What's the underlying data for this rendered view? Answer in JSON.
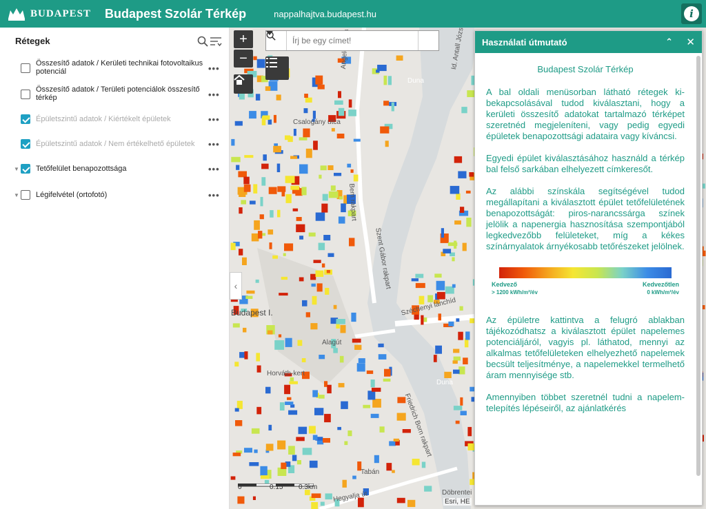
{
  "header": {
    "logo_text": "BUDAPEST",
    "title": "Budapest Szolár Térkép",
    "url": "nappalhajtva.budapest.hu"
  },
  "layers_panel": {
    "title": "Rétegek",
    "items": [
      {
        "label": "Összesítő adatok / Kerületi technikai fotovoltaikus potenciál",
        "checked": false,
        "dim": false
      },
      {
        "label": "Összesítő adatok / Területi potenciálok összesítő térkép",
        "checked": false,
        "dim": false
      },
      {
        "label": "Épületszintű adatok / Kiértékelt épületek",
        "checked": true,
        "dim": true
      },
      {
        "label": "Épületszintű adatok / Nem értékelhető épületek",
        "checked": true,
        "dim": true
      },
      {
        "label": "Tetőfelület benapozottsága",
        "checked": true,
        "dim": false
      },
      {
        "label": "Légifelvétel (ortofotó)",
        "checked": false,
        "dim": false
      }
    ],
    "more_label": "•••"
  },
  "map": {
    "search_placeholder": "Írj be egy címet!",
    "zoom_in": "+",
    "zoom_out": "−",
    "labels": {
      "csalogany": "Csalogány utca",
      "angelo": "Angelo Rotta rakpart",
      "dune1": "Duna",
      "dune2": "Duna",
      "bem": "Bem rakpart",
      "szechenyi": "Széchenyi lánchíd",
      "szeht": "Szent Gábor rakpart",
      "budapest1": "Budapest I.",
      "alagut": "Alagút",
      "horvath": "Horváth-kert",
      "tabán": "Tabán",
      "hegyalja": "Hegyalja út",
      "dobrentei": "Döbrentei",
      "frigyes": "Friedrich Born rakpart",
      "jozsef": "Id. Antall József rakpart"
    },
    "scale_labels": [
      "0",
      "0.15",
      "0.3km"
    ],
    "attribution": "Esri, HE"
  },
  "guide": {
    "title": "Használati útmutató",
    "subtitle": "Budapest Szolár Térkép",
    "paragraphs": [
      "A bal oldali menüsorban látható rétegek ki-bekapcsolásával tudod kiválasztani, hogy a kerületi összesítő adatokat tartalmazó térképet szeretnéd megjeleníteni, vagy pedig egyedi épületek benapozottsági adataira vagy kíváncsi.",
      "Egyedi épület kiválasztásához használd a térkép bal felső sarkában elhelyezett címkeresőt.",
      "Az alábbi színskála segítségével tudod megállapítani a kiválasztott épület tetőfelületének benapozottságát: piros-narancssárga színek jelölik a napenergia hasznosítása szempontjából legkedvezőbb felületeket, míg a kékes színárnyalatok árnyékosabb tetőrészeket jelölnek.",
      "Az épületre kattintva a felugró ablakban tájékozódhatsz a kiválasztott épület napelemes potenciáljáról, vagyis pl. láthatod, mennyi az alkalmas tetőfelületeken elhelyezhető napelemek becsült teljesítménye, a napelemekkel termelhető áram mennyisége stb.",
      "Amennyiben többet szeretnél tudni a napelem-telepítés lépéseiről, az ajánlatkérés"
    ],
    "legend": {
      "left_label": "Kedvező",
      "right_label": "Kedvezőtlen",
      "left_unit": "> 1200 kWh/m²/év",
      "right_unit": "0 kWh/m²/év"
    }
  },
  "colors": {
    "brand": "#1e9b86",
    "river": "#d7dbdd"
  }
}
